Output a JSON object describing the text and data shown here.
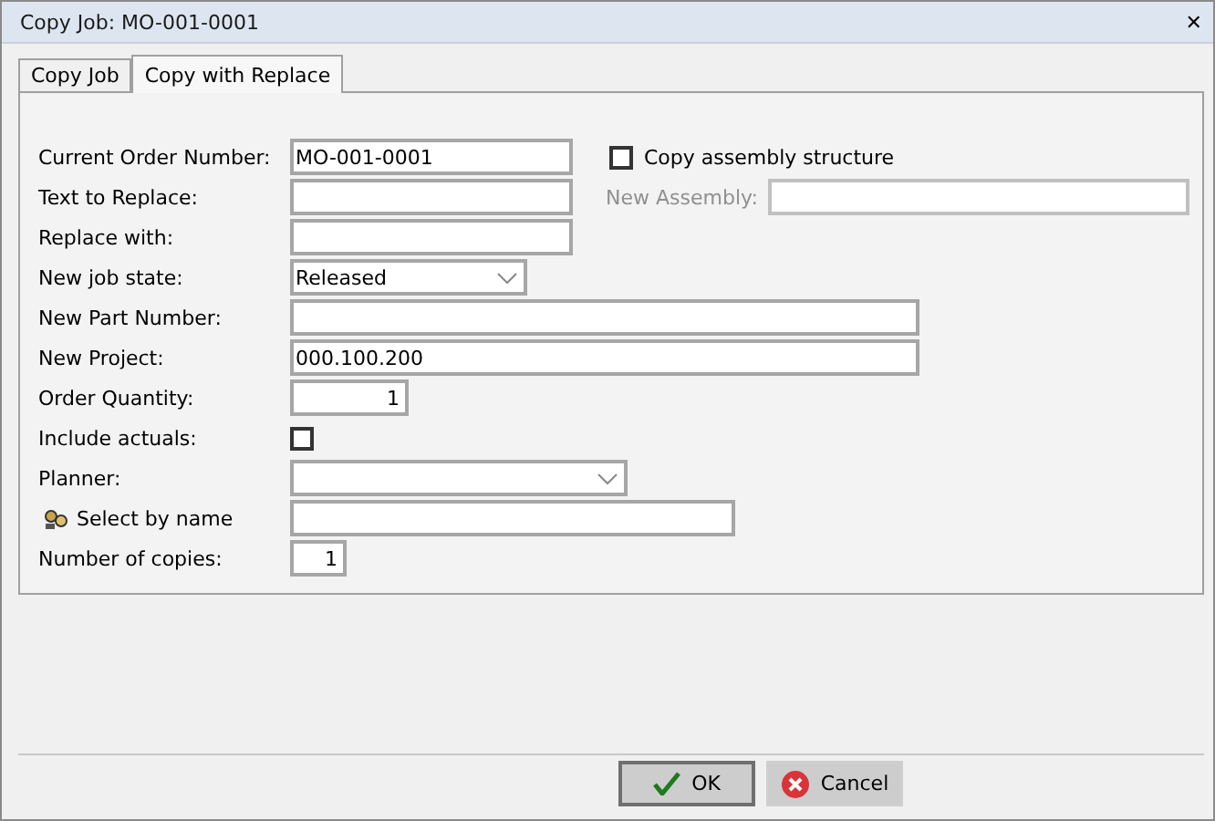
{
  "window": {
    "title": "Copy Job:  MO-001-0001",
    "close": "✕"
  },
  "tabs": [
    {
      "label": "Copy Job",
      "selected": false
    },
    {
      "label": "Copy with Replace",
      "selected": true
    }
  ],
  "fields": [
    {
      "kind": "text",
      "label": "Current Order Number:",
      "value": "MO-001-0001"
    },
    {
      "kind": "text",
      "label": "Text to Replace:"
    },
    {
      "kind": "text",
      "label": "Replace with:"
    },
    {
      "kind": "dropdown",
      "label": "New job state:",
      "value": "Released"
    },
    {
      "kind": "text",
      "label": "New Part Number:"
    },
    {
      "kind": "text",
      "label": "New Project:",
      "value": "000.100.200"
    },
    {
      "kind": "number",
      "label": "Order Quantity:",
      "value": "1"
    },
    {
      "kind": "checkbox",
      "label": "Include actuals:",
      "checked": false
    },
    {
      "kind": "dropdown",
      "label": "Planner:"
    },
    {
      "kind": "lookup",
      "label": "Select by name"
    },
    {
      "kind": "number",
      "label": "Number of copies:",
      "value": "1"
    }
  ],
  "assembly": {
    "copy_label": "Copy assembly structure",
    "checked": false,
    "new_label": "New Assembly:",
    "disabled": true
  },
  "buttons": [
    {
      "kind": "ok",
      "label": "OK"
    },
    {
      "kind": "cancel",
      "label": "Cancel"
    }
  ]
}
